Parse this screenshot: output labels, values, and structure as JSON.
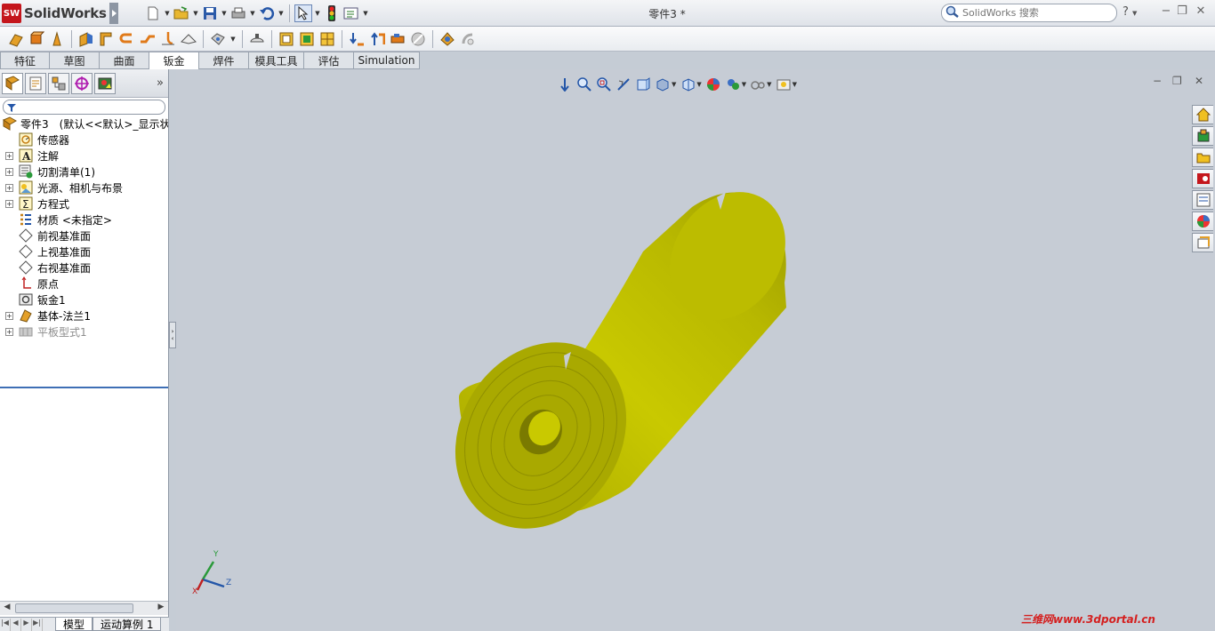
{
  "app": {
    "name": "SolidWorks",
    "logo_text": "SW",
    "document_title": "零件3 *"
  },
  "search": {
    "placeholder": "SolidWorks 搜索"
  },
  "help_label": "?",
  "tabs": [
    {
      "label": "特征",
      "active": false
    },
    {
      "label": "草图",
      "active": false
    },
    {
      "label": "曲面",
      "active": false
    },
    {
      "label": "钣金",
      "active": true
    },
    {
      "label": "焊件",
      "active": false
    },
    {
      "label": "模具工具",
      "active": false
    },
    {
      "label": "评估",
      "active": false
    },
    {
      "label": "Simulation",
      "active": false
    }
  ],
  "tree": {
    "root_label": "零件3　(默认<<默认>_显示状态",
    "items": [
      {
        "label": "传感器",
        "icon": "sensor-icon",
        "expandable": false
      },
      {
        "label": "注解",
        "icon": "annotation-icon",
        "expandable": true
      },
      {
        "label": "切割清单(1)",
        "icon": "cutlist-icon",
        "expandable": true
      },
      {
        "label": "光源、相机与布景",
        "icon": "lights-icon",
        "expandable": true
      },
      {
        "label": "方程式",
        "icon": "equation-icon",
        "expandable": true
      },
      {
        "label": "材质 <未指定>",
        "icon": "material-icon",
        "expandable": false
      },
      {
        "label": "前视基准面",
        "icon": "plane-icon",
        "expandable": false
      },
      {
        "label": "上视基准面",
        "icon": "plane-icon",
        "expandable": false
      },
      {
        "label": "右视基准面",
        "icon": "plane-icon",
        "expandable": false
      },
      {
        "label": "原点",
        "icon": "origin-icon",
        "expandable": false
      },
      {
        "label": "钣金1",
        "icon": "sheetmetal-icon",
        "expandable": false
      },
      {
        "label": "基体-法兰1",
        "icon": "baseflange-icon",
        "expandable": true
      },
      {
        "label": "平板型式1",
        "icon": "flatpattern-icon",
        "expandable": true,
        "suppressed": true
      }
    ]
  },
  "bottom_tabs": [
    {
      "label": "模型",
      "active": true
    },
    {
      "label": "运动算例 1",
      "active": false
    }
  ],
  "triad": {
    "x": "X",
    "y": "Y",
    "z": "Z"
  },
  "watermark": "三维网www.3dportal.cn",
  "colors": {
    "viewport_bg": "#c6ccd5",
    "part_color": "#c8c800",
    "rollback_bar": "#3e6fb5",
    "watermark": "#d41f1f"
  }
}
